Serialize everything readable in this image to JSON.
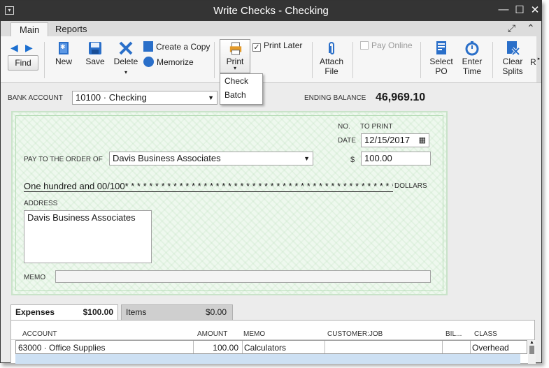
{
  "window": {
    "title": "Write Checks - Checking",
    "sys_icon": "window-menu-icon",
    "controls": {
      "minimize": "—",
      "maximize": "☐",
      "close": "✕"
    }
  },
  "tabs": [
    {
      "label": "Main"
    },
    {
      "label": "Reports"
    }
  ],
  "ribbon": {
    "find": "Find",
    "new": "New",
    "save": "Save",
    "delete": "Delete",
    "create_copy": "Create a Copy",
    "memorize": "Memorize",
    "print": "Print",
    "print_later": "Print Later",
    "attach_file_1": "Attach",
    "attach_file_2": "File",
    "pay_online": "Pay Online",
    "select_po_1": "Select",
    "select_po_2": "PO",
    "enter_time_1": "Enter",
    "enter_time_2": "Time",
    "clear_splits_1": "Clear",
    "clear_splits_2": "Splits",
    "more": "R",
    "print_later_checked": "✓"
  },
  "print_menu": {
    "items": [
      "Check",
      "Batch"
    ]
  },
  "bank": {
    "label": "BANK ACCOUNT",
    "value": "10100 · Checking",
    "ending_label": "ENDING BALANCE",
    "ending_value": "46,969.10"
  },
  "check": {
    "no_label": "NO.",
    "no_value": "TO PRINT",
    "date_label": "DATE",
    "date_value": "12/15/2017",
    "payto_label": "PAY TO THE ORDER OF",
    "payee": "Davis Business Associates",
    "dollar_sign": "$",
    "amount": "100.00",
    "amount_words": "One hundred and 00/100* * * * * * * * * * * * * * * * * * * * * * * * * * * * * * * * * * * * * * * * * * * * * * * * * * * * * * *",
    "dollars_label": "DOLLARS",
    "address_label": "ADDRESS",
    "address": "Davis Business Associates",
    "memo_label": "MEMO",
    "memo": ""
  },
  "bottom_tabs": {
    "expenses_label": "Expenses",
    "expenses_total": "$100.00",
    "items_label": "Items",
    "items_total": "$0.00"
  },
  "grid": {
    "headers": [
      "ACCOUNT",
      "AMOUNT",
      "MEMO",
      "CUSTOMER:JOB",
      "BIL...",
      "CLASS"
    ],
    "rows": [
      {
        "account": "63000 · Office Supplies",
        "amount": "100.00",
        "memo": "Calculators",
        "customer": "",
        "billable": "",
        "class": "Overhead"
      }
    ]
  }
}
